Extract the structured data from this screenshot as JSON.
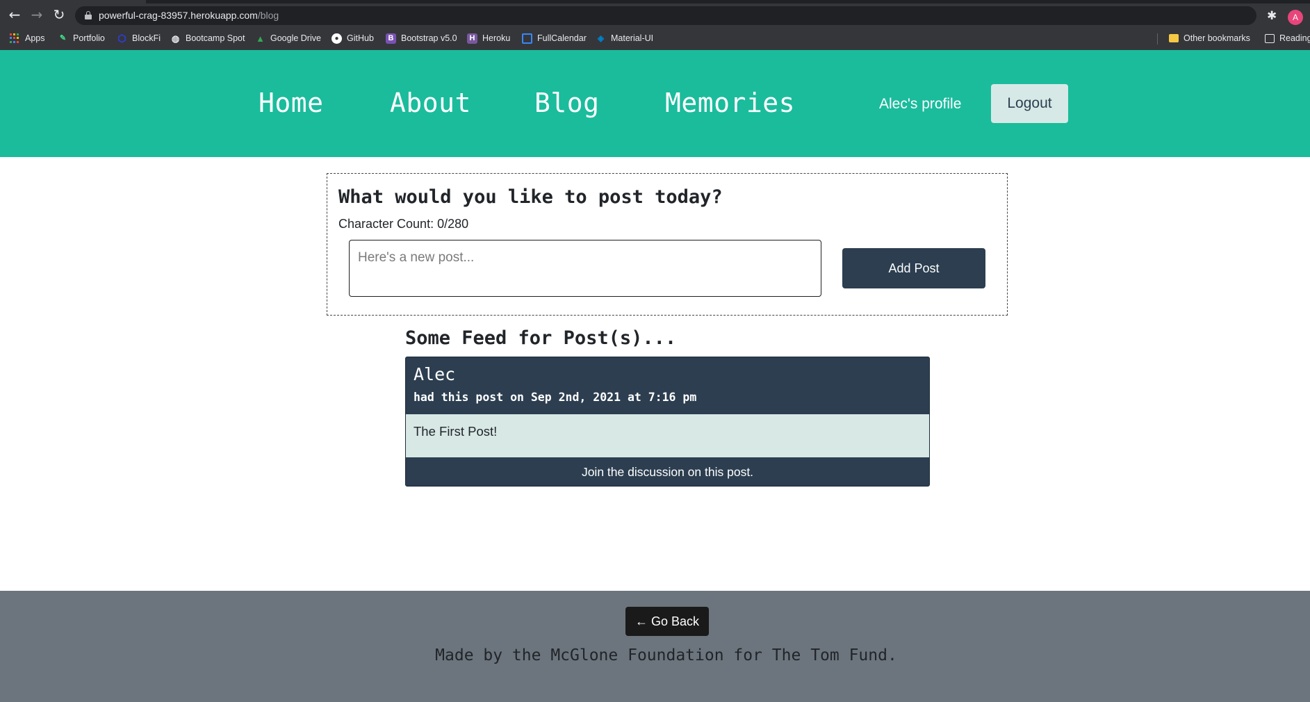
{
  "browser": {
    "url_host": "powerful-crag-83957.herokuapp.com",
    "url_path": "/blog",
    "avatar_letter": "A",
    "icons": {
      "back": "back-arrow-icon",
      "forward": "forward-arrow-icon",
      "reload": "reload-icon",
      "lock": "lock-icon",
      "star": "star-icon",
      "extensions": "puzzle-icon"
    },
    "bookmarks": [
      {
        "label": "Apps",
        "icon": "apps-grid-icon"
      },
      {
        "label": "Portfolio",
        "icon": "pencil-icon",
        "color": "#3ddc84"
      },
      {
        "label": "BlockFi",
        "icon": "hexagon-icon",
        "color": "#2d3ef5"
      },
      {
        "label": "Bootcamp Spot",
        "icon": "globe-icon",
        "color": "#e8eaed"
      },
      {
        "label": "Google Drive",
        "icon": "drive-icon",
        "color": "#34a853"
      },
      {
        "label": "GitHub",
        "icon": "github-icon",
        "color": "#ffffff"
      },
      {
        "label": "Bootstrap v5.0",
        "icon": "bootstrap-icon",
        "color": "#7952b3"
      },
      {
        "label": "Heroku",
        "icon": "heroku-icon",
        "color": "#79589f"
      },
      {
        "label": "FullCalendar",
        "icon": "calendar-icon",
        "color": "#3a87f5"
      },
      {
        "label": "Material-UI",
        "icon": "material-ui-icon",
        "color": "#0081cb"
      }
    ],
    "other_bookmarks": "Other bookmarks",
    "reading_list": "Reading"
  },
  "header": {
    "nav": [
      "Home",
      "About",
      "Blog",
      "Memories"
    ],
    "profile_label": "Alec's profile",
    "logout_label": "Logout",
    "bg_color": "#1abc9c"
  },
  "composer": {
    "title": "What would you like to post today?",
    "char_count": "Character Count: 0/280",
    "input_value": "",
    "placeholder": "Here's a new post...",
    "submit_label": "Add Post"
  },
  "feed": {
    "title": "Some Feed for Post(s)...",
    "posts": [
      {
        "author": "Alec",
        "meta": "had this post on Sep 2nd, 2021 at 7:16 pm",
        "text": "The First Post!",
        "discuss_label": "Join the discussion on this post."
      }
    ]
  },
  "footer": {
    "back_label": "← Go Back",
    "credit": "Made by the McGlone Foundation for The Tom Fund."
  },
  "colors": {
    "dark": "#2c3e50",
    "post_body": "#d8e8e5",
    "footer": "#6c757d"
  }
}
